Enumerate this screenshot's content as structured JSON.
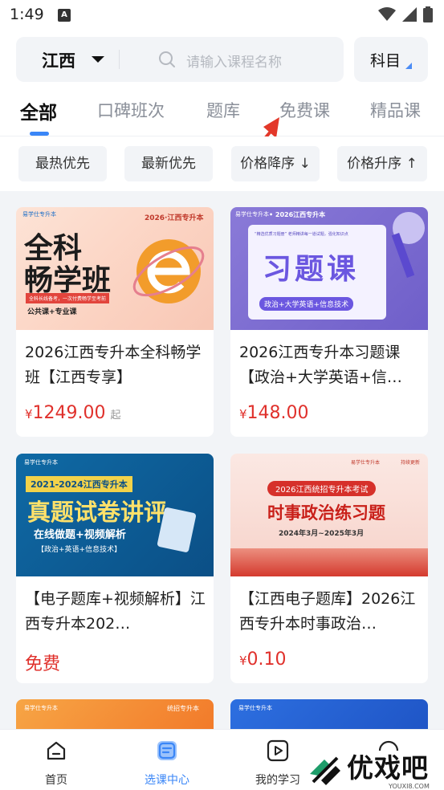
{
  "status_bar": {
    "time": "1:49",
    "a_icon": "A"
  },
  "header": {
    "region": "江西",
    "search_placeholder": "请输入课程名称",
    "subject_label": "科目"
  },
  "tabs": [
    {
      "label": "全部",
      "active": true
    },
    {
      "label": "口碑班次",
      "active": false
    },
    {
      "label": "题库",
      "active": false
    },
    {
      "label": "免费课",
      "active": false
    },
    {
      "label": "精品课",
      "active": false
    }
  ],
  "sort_options": [
    "最热优先",
    "最新优先",
    "价格降序 ↓",
    "价格升序 ↑"
  ],
  "cards": [
    {
      "title": "2026江西专升本全科畅学班【江西专享】",
      "currency": "¥",
      "price": "1249.00",
      "price_suffix": "起",
      "thumb": {
        "brand": "易学仕专升本",
        "tag": "2026·江西专升本",
        "headline_1": "全科",
        "headline_2": "畅学班",
        "tagline": "全科长线备考，一次付费畅学至考前",
        "footer": "公共课+专业课"
      }
    },
    {
      "title": "2026江西专升本习题课【政治+大学英语+信…",
      "currency": "¥",
      "price": "148.00",
      "price_suffix": "",
      "thumb": {
        "brand": "易学仕专升本",
        "tag": "• 2026江西专升本",
        "tagline": "“精选优质习题册” 老师精讲每一道试题，强化知识点",
        "headline": "习题课",
        "footer": "政治+大学英语+信息技术"
      }
    },
    {
      "title": "【电子题库+视频解析】江西专升本202…",
      "price_text": "免费",
      "thumb": {
        "brand": "易学仕专升本",
        "tag": "2021-2024江西专升本",
        "headline": "真题试卷讲评",
        "line2": "在线做题+视频解析",
        "footer": "【政治+英语+信息技术】"
      }
    },
    {
      "title": "【江西电子题库】2026江西专升本时事政治…",
      "currency": "¥",
      "price": "0.10",
      "price_suffix": "",
      "thumb": {
        "brand": "易学仕专升本",
        "corner": "持续更新",
        "ribbon": "2026江西统招专升本考试",
        "headline": "时事政治练习题",
        "dates": "2024年3月~2025年3月"
      }
    }
  ],
  "partial_cards": [
    {
      "brand": "易学仕专升本",
      "tag": "统招专升本"
    },
    {
      "brand": "易学仕专升本"
    }
  ],
  "bottom_nav": [
    {
      "label": "首页",
      "icon": "home-icon",
      "active": false
    },
    {
      "label": "选课中心",
      "icon": "course-center-icon",
      "active": true
    },
    {
      "label": "我的学习",
      "icon": "play-icon",
      "active": false
    },
    {
      "label": "",
      "icon": "message-icon",
      "active": false
    }
  ],
  "watermark": {
    "text": "优戏吧",
    "url": "YOUXI8.COM"
  },
  "colors": {
    "accent": "#3a86f7",
    "price_red": "#e0312c",
    "background": "#f2f4f7"
  }
}
